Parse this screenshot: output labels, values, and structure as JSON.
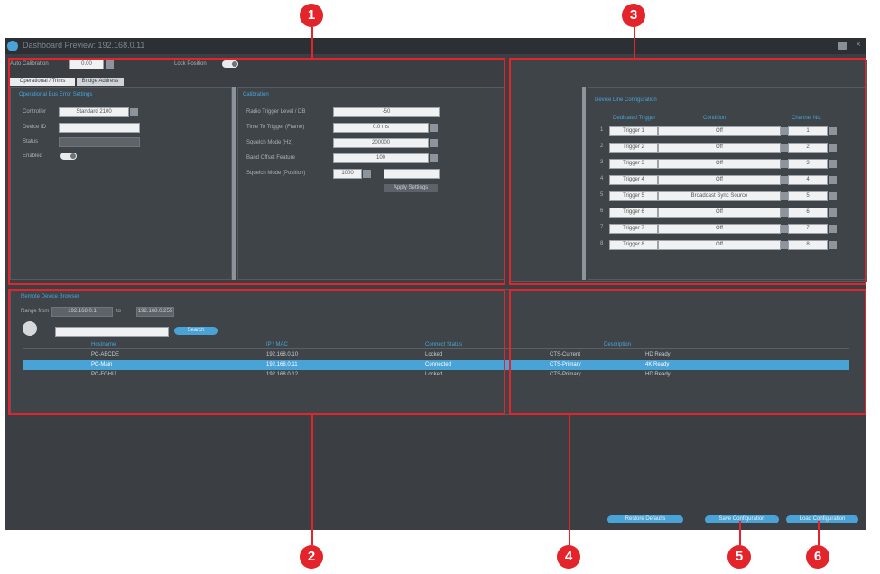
{
  "window": {
    "title": "Dashboard Preview: 192.168.0.11"
  },
  "top_bar": {
    "auto_calibration_label": "Auto Calibration",
    "auto_calibration_value": "0.00",
    "lock_position_label": "Lock Position"
  },
  "tabs": [
    {
      "label": "Operational / Trims"
    },
    {
      "label": "Bridge Address"
    }
  ],
  "panel_left": {
    "section_title": "Operational Bus Error Settings",
    "fields": [
      {
        "label": "Controller",
        "value": "Standard 2100"
      },
      {
        "label": "Device ID",
        "value": ""
      },
      {
        "label": "Status",
        "value": ""
      },
      {
        "label": "Enabled"
      }
    ]
  },
  "panel_mid": {
    "section_title": "Calibration",
    "fields": [
      {
        "label": "Radio Trigger Level / DB",
        "value": "-50"
      },
      {
        "label": "Time To Trigger (Frame)",
        "value": "0.0 ms"
      },
      {
        "label": "Squelch Mode (Hz)",
        "value": "200000"
      },
      {
        "label": "Band Offset Feature",
        "value": "100"
      },
      {
        "label": "Squelch Mode (Position)",
        "value": "1000"
      }
    ],
    "apply_button": "Apply Settings"
  },
  "panel_right": {
    "section_title": "Device Line Configuration",
    "columns": [
      "Dedicated Trigger",
      "Condition",
      "Channel No."
    ],
    "rows": [
      {
        "index": "1",
        "trigger": "Trigger 1",
        "condition": "Off",
        "channel": "1"
      },
      {
        "index": "2",
        "trigger": "Trigger 2",
        "condition": "Off",
        "channel": "2"
      },
      {
        "index": "3",
        "trigger": "Trigger 3",
        "condition": "Off",
        "channel": "3"
      },
      {
        "index": "4",
        "trigger": "Trigger 4",
        "condition": "Off",
        "channel": "4"
      },
      {
        "index": "5",
        "trigger": "Trigger 5",
        "condition": "Broadcast Sync Source",
        "channel": "5"
      },
      {
        "index": "6",
        "trigger": "Trigger 6",
        "condition": "Off",
        "channel": "6"
      },
      {
        "index": "7",
        "trigger": "Trigger 7",
        "condition": "Off",
        "channel": "7"
      },
      {
        "index": "8",
        "trigger": "Trigger 8",
        "condition": "Off",
        "channel": "8"
      }
    ]
  },
  "network": {
    "section_title": "Remote Device Browser",
    "from_label": "Range from",
    "from_value": "192.168.0.1",
    "to_label": "to",
    "to_value": "192.168.0.255",
    "search_placeholder": "",
    "search_button": "Search",
    "columns": [
      "Hostname",
      "IP / MAC",
      "Connect Status",
      "Description"
    ],
    "rows": [
      {
        "host": "PC-ABCDE",
        "ip": "192.168.0.10",
        "status": "Locked",
        "desc1": "CTS-Current",
        "desc2": "HD Ready"
      },
      {
        "host": "PC-Main",
        "ip": "192.168.0.11",
        "status": "Connected",
        "desc1": "CTS-Primary",
        "desc2": "4K Ready"
      },
      {
        "host": "PC-FGHIJ",
        "ip": "192.168.0.12",
        "status": "Locked",
        "desc1": "CTS-Primary",
        "desc2": "HD Ready"
      }
    ],
    "selected_row": 1
  },
  "footer": {
    "button_1": "Restore Defaults",
    "button_2": "Save Configuration",
    "button_3": "Load Configuration"
  },
  "annotations": {
    "b1": "1",
    "b2": "2",
    "b3": "3",
    "b4": "4",
    "b5": "5",
    "b6": "6"
  },
  "colors": {
    "accent": "#4aa3d6",
    "annotation": "#e3242b",
    "window_bg": "#3b3f44"
  }
}
